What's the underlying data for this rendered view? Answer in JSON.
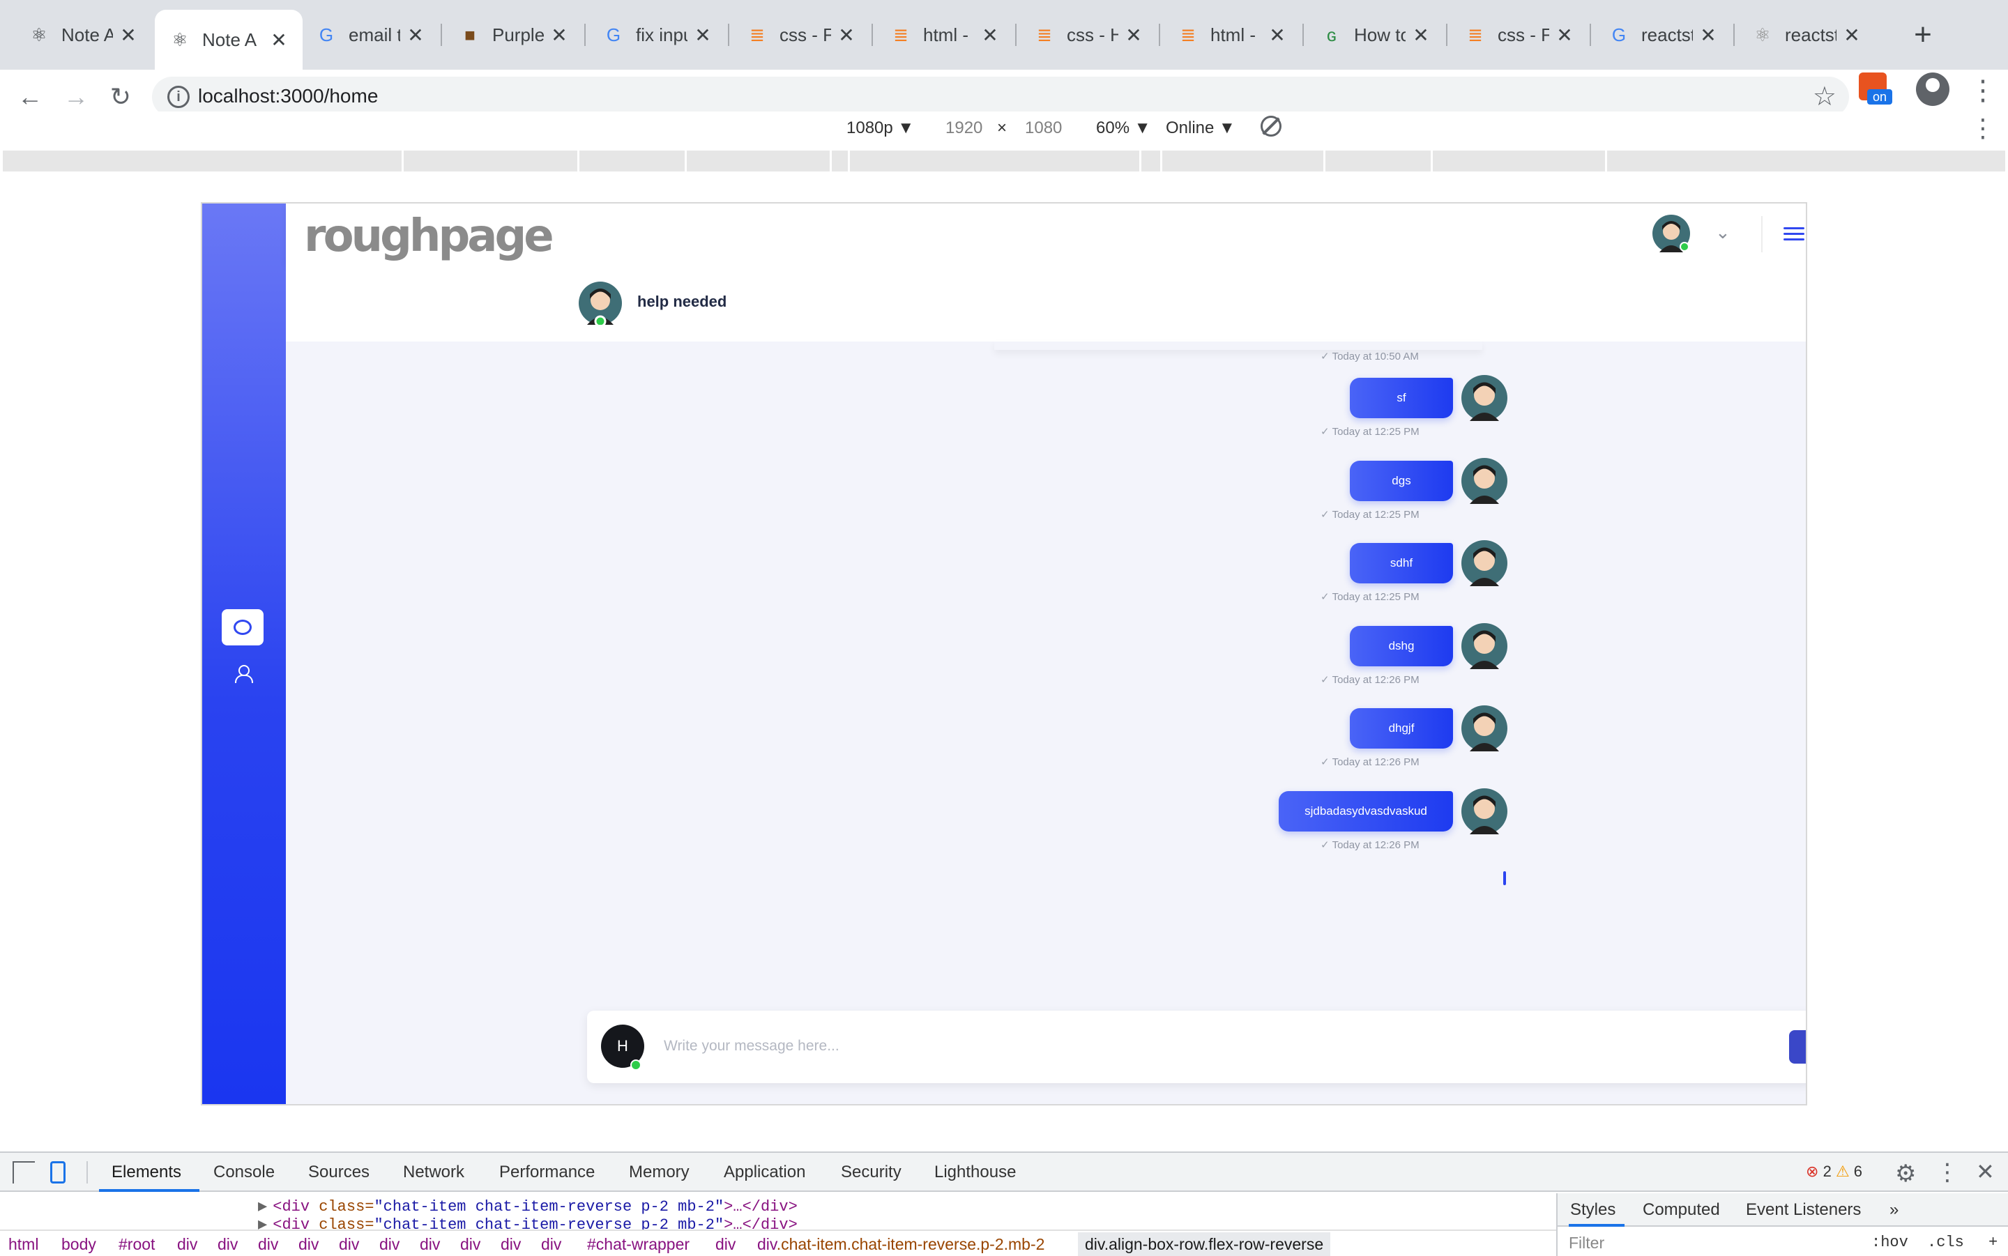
{
  "browser": {
    "tabs": [
      {
        "title": "Note A",
        "icon": "react-icon",
        "active": false
      },
      {
        "title": "Note A",
        "icon": "react-icon",
        "active": true
      },
      {
        "title": "email to",
        "icon": "google-icon",
        "active": false
      },
      {
        "title": "Purple",
        "icon": "site-icon",
        "active": false
      },
      {
        "title": "fix inpu",
        "icon": "google-icon",
        "active": false
      },
      {
        "title": "css - F",
        "icon": "stackoverflow-icon",
        "active": false
      },
      {
        "title": "html - ",
        "icon": "stackoverflow-icon",
        "active": false
      },
      {
        "title": "css - H",
        "icon": "stackoverflow-icon",
        "active": false
      },
      {
        "title": "html - ",
        "icon": "stackoverflow-icon",
        "active": false
      },
      {
        "title": "How to",
        "icon": "geeksforgeeks-icon",
        "active": false
      },
      {
        "title": "css - F",
        "icon": "stackoverflow-icon",
        "active": false
      },
      {
        "title": "reactst",
        "icon": "google-icon",
        "active": false
      },
      {
        "title": "reactst",
        "icon": "reactstrap-icon",
        "active": false
      }
    ],
    "close_glyph": "✕",
    "new_tab_glyph": "+",
    "url": "localhost:3000/home",
    "back_glyph": "←",
    "forward_glyph": "→",
    "reload_glyph": "↻",
    "star_glyph": "☆",
    "extension_badge": "on",
    "menu_glyph": "⋮"
  },
  "device_toolbar": {
    "preset": "1080p ▼",
    "width": "1920",
    "times": "×",
    "height": "1080",
    "zoom": "60% ▼",
    "network": "Online ▼",
    "menu_glyph": "⋮"
  },
  "app": {
    "logo_text": "roughpage",
    "accent_color": "#2a43f0",
    "topbar_chevron": "⌄",
    "chat_header": {
      "name": "help needed"
    },
    "messages": [
      {
        "text": "sf",
        "time": "Today at 12:25 PM"
      },
      {
        "text": "dgs",
        "time": "Today at 12:25 PM"
      },
      {
        "text": "sdhf",
        "time": "Today at 12:25 PM"
      },
      {
        "text": "dshg",
        "time": "Today at 12:26 PM"
      },
      {
        "text": "dhgjf",
        "time": "Today at 12:26 PM"
      },
      {
        "text": "sjdbadasydvasdvaskud",
        "time": "Today at 12:26 PM"
      }
    ],
    "earlier_time": "Today at 10:50 AM",
    "check_glyph": "✓",
    "composer": {
      "avatar_initial": "H",
      "placeholder": "Write your message here..."
    }
  },
  "devtools": {
    "tabs": [
      "Elements",
      "Console",
      "Sources",
      "Network",
      "Performance",
      "Memory",
      "Application",
      "Security",
      "Lighthouse"
    ],
    "more_glyph": "»",
    "errors": "2",
    "warnings": "6",
    "error_glyph": "⊗",
    "warning_glyph": "⚠",
    "gear_glyph": "⚙",
    "kebab_glyph": "⋮",
    "close_glyph": "✕",
    "code_line_1": {
      "tag_open": "<div ",
      "attr": "class=",
      "value": "\"chat-item chat-item-reverse p-2 mb-2\"",
      "tail": ">…</div>"
    },
    "code_line_2": {
      "tag_open": "<div ",
      "attr": "class=",
      "value": "\"chat-item chat-item-reverse p-2 mb-2\"",
      "tail": ">…</div>"
    },
    "breadcrumbs": [
      "html",
      "body",
      "#root",
      "div",
      "div",
      "div",
      "div",
      "div",
      "div",
      "div",
      "div",
      "div",
      "div",
      "#chat-wrapper",
      "div"
    ],
    "crumb_selected_tag": "div",
    "crumb_selected_class": ".chat-item.chat-item-reverse.p-2.mb-2",
    "crumb_last": "div.align-box-row.flex-row-reverse",
    "styles_tabs": [
      "Styles",
      "Computed",
      "Event Listeners"
    ],
    "filter_placeholder": "Filter",
    "hov": ":hov",
    "cls": ".cls",
    "plus_glyph": "+"
  }
}
